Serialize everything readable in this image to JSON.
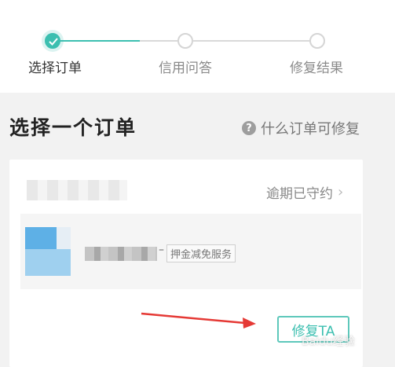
{
  "stepper": {
    "steps": [
      {
        "label": "选择订单",
        "state": "done"
      },
      {
        "label": "信用问答",
        "state": "pending"
      },
      {
        "label": "修复结果",
        "state": "pending"
      }
    ],
    "accent": "#3cbfb0"
  },
  "section": {
    "title": "选择一个订单",
    "help_label": "什么订单可修复",
    "help_icon": "question-circle-icon"
  },
  "order": {
    "status": "逾期已守约",
    "status_icon": "chevron-right-icon",
    "tag": "押金减免服务",
    "fix_button_label": "修复TA"
  },
  "watermark": {
    "text": "Baidu经验"
  },
  "colors": {
    "background": "#f2f2f2",
    "card": "#ffffff",
    "accent": "#3cbfb0",
    "arrow": "#e53935"
  }
}
